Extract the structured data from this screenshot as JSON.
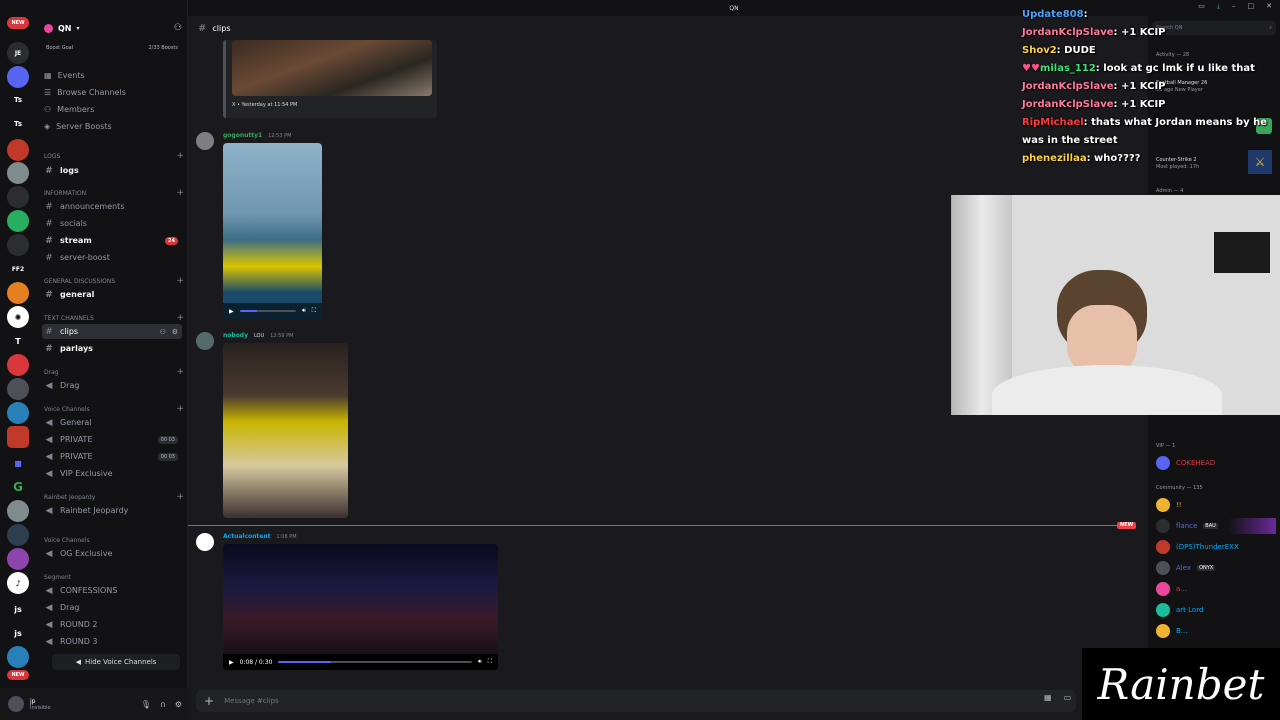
{
  "window": {
    "title": "QN"
  },
  "server": {
    "name": "QN",
    "boost_goal_label": "Boost Goal",
    "boost_count": "2/33 Boosts"
  },
  "rail": {
    "badges": [
      "NEW",
      "NEW"
    ],
    "labels": [
      "JE",
      "Ts",
      "Ts",
      "FF2",
      "T",
      "js",
      "js"
    ]
  },
  "nav": [
    "Events",
    "Browse Channels",
    "Members",
    "Server Boosts"
  ],
  "categories": {
    "logs": "LOGS",
    "information": "INFORMATION",
    "general_discussions": "GENERAL DISCUSSIONS",
    "text_channels": "TEXT CHANNELS",
    "drag": "Drag",
    "voice_channels": "Voice Channels",
    "rainbet_jeopardy": "Rainbet Jeopardy",
    "voice_channels_2": "Voice Channels",
    "segment": "Segment"
  },
  "channels": {
    "logs": "logs",
    "announcements": "announcements",
    "socials": "socials",
    "stream": "stream",
    "stream_badge": "24",
    "server_boost": "server-boost",
    "general": "general",
    "clips": "clips",
    "parlays": "parlays",
    "drag": "Drag",
    "vc_general": "General",
    "private1": "PRIVATE",
    "private1_count": "00 03",
    "private2": "PRIVATE",
    "private2_count": "00 03",
    "vip": "VIP Exclusive",
    "rainbet": "Rainbet Jeopardy",
    "og": "OG Exclusive",
    "confessions": "CONFESSIONS",
    "seg_drag": "Drag",
    "round2": "ROUND 2",
    "round3": "ROUND 3"
  },
  "hide_voice": "Hide Voice Channels",
  "user": {
    "name": "jp",
    "status": "Invisible"
  },
  "channel_header": {
    "name": "clips"
  },
  "messages": [
    {
      "embed_footer": "X • Yesterday at 11:54 PM"
    },
    {
      "author": "gogonutty1",
      "time": "12:53 PM",
      "author_color": "#3ba55c"
    },
    {
      "author": "nobody",
      "role_tag": "LOU",
      "time": "12:59 PM",
      "author_color": "#1abc9c"
    },
    {
      "author": "Actualcontent",
      "time": "1:08 PM",
      "author_color": "#00a8fc",
      "video_time": "0:08 / 0:30",
      "progress": 0.27
    }
  ],
  "new_marker": "NEW",
  "composer": {
    "placeholder": "Message #clips"
  },
  "member_list": {
    "search_placeholder": "Search QN",
    "activity_header": "Activity — 28",
    "activities": [
      {
        "game": "Football Manager 26",
        "detail": "1d ago  New Player"
      },
      {
        "game": "Counter-Strike 2",
        "detail": "Most played: 17h"
      }
    ],
    "admin_header": "Admin — 4",
    "vip_header": "VIP — 1",
    "vip_members": [
      {
        "name": "COKEHEAD",
        "color": "#da373c"
      }
    ],
    "community_header": "Community — 135",
    "community_members": [
      {
        "name": "!!",
        "color": "#f0b232"
      },
      {
        "name": "flance",
        "tag": "BAU",
        "color": "#5865f2"
      },
      {
        "name": "(DPS)ThunderEXX",
        "color": "#00a8fc"
      },
      {
        "name": "Alex",
        "tag": "ONYX",
        "color": "#5865f2"
      },
      {
        "name": "a...",
        "color": "#da373c"
      },
      {
        "name": "art Lord",
        "color": "#00a8fc"
      },
      {
        "name": "B...",
        "color": "#00a8fc"
      }
    ]
  },
  "stream_chat": [
    {
      "user": "Update808",
      "color": "#4aa3ff",
      "text": ""
    },
    {
      "user": "JordanKclpSlave",
      "color": "#ff7b9c",
      "text": "+1 KCIP"
    },
    {
      "user": "Shov2",
      "color": "#ffd23f",
      "text": "DUDE"
    },
    {
      "user": "milas_112",
      "color": "#3fe07a",
      "text": "look at gc lmk if u like that"
    },
    {
      "user": "JordanKclpSlave",
      "color": "#ff7b9c",
      "text": "+1 KCIP"
    },
    {
      "user": "JordanKclpSlave",
      "color": "#ff7b9c",
      "text": "+1 KCIP"
    },
    {
      "user": "RipMichael",
      "color": "#ff3b3b",
      "text": "thats what Jordan means by he"
    },
    {
      "user": "",
      "color": "#ffffff",
      "text": "was in the street"
    },
    {
      "user": "phenezillaa",
      "color": "#ffd23f",
      "text": "who????"
    }
  ],
  "logo_text": "Rainbet"
}
